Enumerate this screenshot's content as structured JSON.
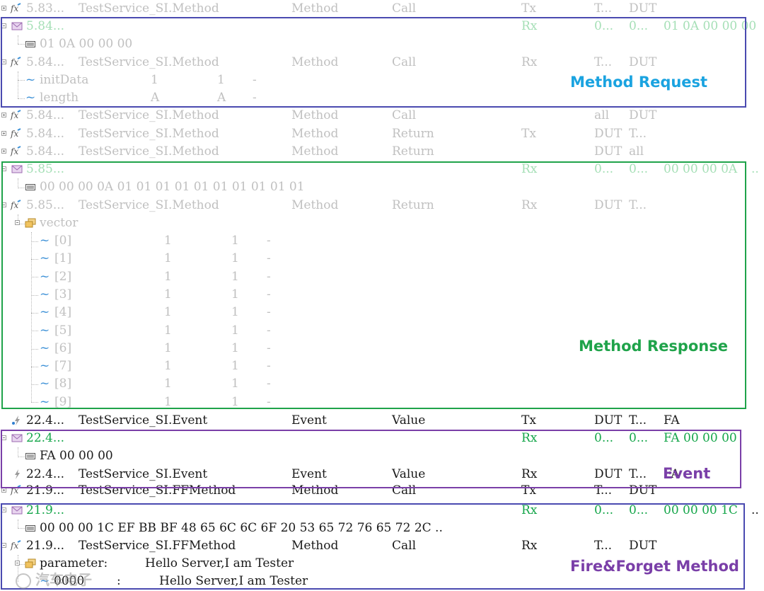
{
  "rows": [
    {
      "ts": "5.83...",
      "name": "TestService_SI.Method",
      "type": "Method",
      "kind": "Call",
      "dir": "Tx",
      "c1": "T...",
      "c2": "DUT",
      "c3": ""
    },
    {
      "ts": "5.84...",
      "dir": "Rx",
      "c1": "0...",
      "c2": "0...",
      "c3": "01 0A 00 00 00"
    },
    {
      "bytes": "01 0A 00 00 00"
    },
    {
      "ts": "5.84...",
      "name": "TestService_SI.Method",
      "type": "Method",
      "kind": "Call",
      "dir": "Rx",
      "c1": "T...",
      "c2": "DUT"
    },
    {
      "param": "initData",
      "v1": "1",
      "v2": "1",
      "v3": "-"
    },
    {
      "param": "length",
      "v1": "A",
      "v2": "A",
      "v3": "-"
    },
    {
      "ts": "5.84...",
      "name": "TestService_SI.Method",
      "type": "Method",
      "kind": "Call",
      "dir": "",
      "c1": "all",
      "c2": "DUT"
    },
    {
      "ts": "5.84...",
      "name": "TestService_SI.Method",
      "type": "Method",
      "kind": "Return",
      "dir": "Tx",
      "c1": "DUT",
      "c2": "T..."
    },
    {
      "ts": "5.84...",
      "name": "TestService_SI.Method",
      "type": "Method",
      "kind": "Return",
      "dir": "",
      "c1": "DUT",
      "c2": "all"
    },
    {
      "ts": "5.85...",
      "dir": "Rx",
      "c1": "0...",
      "c2": "0...",
      "c3": "00 00 00 0A",
      "c4": ".."
    },
    {
      "bytes": "00 00 00 0A 01 01 01 01 01 01 01 01 01 01"
    },
    {
      "ts": "5.85...",
      "name": "TestService_SI.Method",
      "type": "Method",
      "kind": "Return",
      "dir": "Rx",
      "c1": "DUT",
      "c2": "T..."
    },
    {
      "group": "vector"
    },
    {
      "idx": "[0]",
      "v1": "1",
      "v2": "1",
      "v3": "-"
    },
    {
      "idx": "[1]",
      "v1": "1",
      "v2": "1",
      "v3": "-"
    },
    {
      "idx": "[2]",
      "v1": "1",
      "v2": "1",
      "v3": "-"
    },
    {
      "idx": "[3]",
      "v1": "1",
      "v2": "1",
      "v3": "-"
    },
    {
      "idx": "[4]",
      "v1": "1",
      "v2": "1",
      "v3": "-"
    },
    {
      "idx": "[5]",
      "v1": "1",
      "v2": "1",
      "v3": "-"
    },
    {
      "idx": "[6]",
      "v1": "1",
      "v2": "1",
      "v3": "-"
    },
    {
      "idx": "[7]",
      "v1": "1",
      "v2": "1",
      "v3": "-"
    },
    {
      "idx": "[8]",
      "v1": "1",
      "v2": "1",
      "v3": "-"
    },
    {
      "idx": "[9]",
      "v1": "1",
      "v2": "1",
      "v3": "-"
    },
    {
      "ts": "22.4...",
      "name": "TestService_SI.Event",
      "type": "Event",
      "kind": "Value",
      "dir": "Tx",
      "c1": "DUT",
      "c2": "T...",
      "c3": "FA"
    },
    {
      "ts": "22.4...",
      "dir": "Rx",
      "c1": "0...",
      "c2": "0...",
      "c3": "FA 00 00 00"
    },
    {
      "bytes": "FA 00 00 00"
    },
    {
      "ts": "22.4...",
      "name": "TestService_SI.Event",
      "type": "Event",
      "kind": "Value",
      "dir": "Rx",
      "c1": "DUT",
      "c2": "T...",
      "c3": "FA"
    },
    {
      "ts": "21.9...",
      "name": "TestService_SI.FFMethod",
      "type": "Method",
      "kind": "Call",
      "dir": "Tx",
      "c1": "T...",
      "c2": "DUT"
    },
    {
      "ts": "21.9...",
      "dir": "Rx",
      "c1": "0...",
      "c2": "0...",
      "c3": "00 00 00 1C",
      "c4": ".."
    },
    {
      "bytes": "00 00 00 1C EF BB BF 48 65 6C 6C 6F 20 53 65 72 76 65 72 2C  .."
    },
    {
      "ts": "21.9...",
      "name": "TestService_SI.FFMethod",
      "type": "Method",
      "kind": "Call",
      "dir": "Rx",
      "c1": "T...",
      "c2": "DUT"
    },
    {
      "param": "parameter:",
      "value": "Hello Server,I am Tester"
    },
    {
      "sub": "0000",
      "sep": ":",
      "value": "Hello Server,I am Tester"
    }
  ],
  "boxes": [
    {
      "label": "Method Request",
      "color": "#4a4ab0",
      "label_color": "#1aa3e0"
    },
    {
      "label": "Method Response",
      "color": "#1fa34a",
      "label_color": "#1fa34a"
    },
    {
      "label": "Event",
      "color": "#7a3fa8",
      "label_color": "#7a3fa8"
    },
    {
      "label": "Fire&Forget Method",
      "color": "#4a4ab0",
      "label_color": "#7a3fa8"
    }
  ],
  "watermark": "汽车电子"
}
